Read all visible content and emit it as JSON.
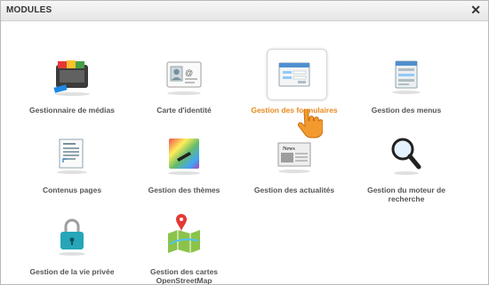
{
  "dialog": {
    "title": "MODULES",
    "close_symbol": "✕"
  },
  "modules": [
    {
      "label": "Gestionnaire de médias",
      "icon": "media-manager-icon"
    },
    {
      "label": "Carte d'identité",
      "icon": "identity-card-icon"
    },
    {
      "label": "Gestion des formulaires",
      "icon": "forms-icon"
    },
    {
      "label": "Gestion des menus",
      "icon": "menus-icon"
    },
    {
      "label": "Contenus pages",
      "icon": "page-contents-icon"
    },
    {
      "label": "Gestion des thèmes",
      "icon": "themes-icon"
    },
    {
      "label": "Gestion des actualités",
      "icon": "news-icon"
    },
    {
      "label": "Gestion du moteur de recherche",
      "icon": "search-engine-icon"
    },
    {
      "label": "Gestion de la vie privée",
      "icon": "privacy-lock-icon"
    },
    {
      "label": "Gestion des cartes OpenStreetMap",
      "icon": "map-icon"
    }
  ],
  "colors": {
    "active_label": "#e8891c",
    "label": "#555555",
    "cursor": "#f29a2e"
  }
}
